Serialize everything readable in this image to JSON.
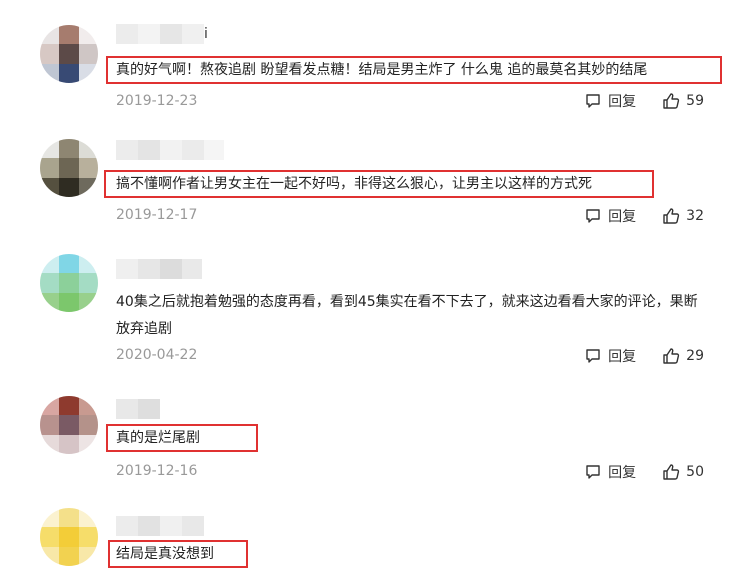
{
  "comments": [
    {
      "username_tail": "i",
      "text": "真的好气啊！熬夜追剧 盼望看发点糖！结局是男主炸了 什么鬼 追的最莫名其妙的结尾",
      "date": "2019-12-23",
      "reply_label": "回复",
      "likes": "59",
      "highlighted": true,
      "avatar_colors": [
        "#e8e4e4",
        "#a67c6e",
        "#f1ecec",
        "#d7c8c4",
        "#5c4a48",
        "#cfc6c5",
        "#bfc6d3",
        "#384a74",
        "#d9dde6"
      ]
    },
    {
      "username_tail": "",
      "text": "搞不懂啊作者让男女主在一起不好吗，非得这么狠心，让男主以这样的方式死",
      "date": "2019-12-17",
      "reply_label": "回复",
      "likes": "32",
      "highlighted": true,
      "avatar_colors": [
        "#e6e6e3",
        "#8e8672",
        "#dcdcd6",
        "#a9a48e",
        "#6d6654",
        "#b8b09c",
        "#55503f",
        "#2f2c22",
        "#6e6a5d"
      ]
    },
    {
      "username_tail": "",
      "text": "40集之后就抱着勉强的态度再看，看到45集实在看不下去了，就来这边看看大家的评论，果断放弃追剧",
      "date": "2020-04-22",
      "reply_label": "回复",
      "likes": "29",
      "highlighted": false,
      "avatar_colors": [
        "#cdeef0",
        "#80d6e6",
        "#cdeef0",
        "#a4dcc4",
        "#8cd09a",
        "#a4dcc4",
        "#98d08c",
        "#7cc76c",
        "#98d08c"
      ]
    },
    {
      "username_tail": "",
      "text": "真的是烂尾剧",
      "date": "2019-12-16",
      "reply_label": "回复",
      "likes": "50",
      "highlighted": true,
      "avatar_colors": [
        "#d8a6a2",
        "#8e3a2e",
        "#c89a90",
        "#b8928e",
        "#7a5a64",
        "#b4928a",
        "#e6dada",
        "#d6c4c6",
        "#ede4e4"
      ]
    },
    {
      "username_tail": "",
      "text": "结局是真没想到",
      "date": "",
      "reply_label": "",
      "likes": "",
      "highlighted": true,
      "avatar_colors": [
        "#fbf2cf",
        "#f4e08a",
        "#fbf2cf",
        "#f6dd6a",
        "#f3cd38",
        "#f6dd6a",
        "#f8e8a8",
        "#f2d250",
        "#f8e8a8"
      ]
    }
  ],
  "colors": {
    "highlight_border": "#e03131",
    "date": "#999999",
    "text": "#222222"
  }
}
